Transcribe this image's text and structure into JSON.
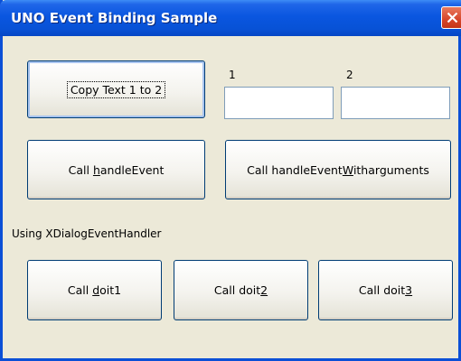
{
  "window": {
    "title": "UNO Event Binding Sample"
  },
  "buttons": {
    "copy_text": "Copy Text 1 to 2",
    "call_handle_event": {
      "pre": "Call ",
      "mnemonic": "h",
      "post": "andleEvent"
    },
    "call_handle_event_args": {
      "pre": "Call handleEvent",
      "mnemonic": "W",
      "post": "itharguments"
    },
    "doit1": {
      "pre": "Call ",
      "mnemonic": "d",
      "post": "oit1"
    },
    "doit2": {
      "pre": "Call doit",
      "mnemonic": "2",
      "post": ""
    },
    "doit3": {
      "pre": "Call doit",
      "mnemonic": "3",
      "post": ""
    }
  },
  "fields": {
    "field1": {
      "label": "1",
      "value": ""
    },
    "field2": {
      "label": "2",
      "value": ""
    }
  },
  "section_label": "Using XDialogEventHandler",
  "icons": {
    "close": "close-icon"
  },
  "colors": {
    "titlebar": "#0a56e0",
    "dialog_bg": "#ece9d8",
    "close_button": "#d6452a"
  }
}
